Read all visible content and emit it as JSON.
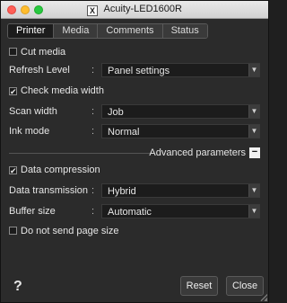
{
  "window": {
    "title": "Acuity-LED1600R",
    "icon": "app-x-icon"
  },
  "tabs": [
    {
      "label": "Printer",
      "active": true
    },
    {
      "label": "Media",
      "active": false
    },
    {
      "label": "Comments",
      "active": false
    },
    {
      "label": "Status",
      "active": false
    }
  ],
  "printer": {
    "cut_media": {
      "label": "Cut media",
      "checked": false
    },
    "refresh_level": {
      "label": "Refresh Level",
      "value": "Panel settings"
    },
    "check_media_width": {
      "label": "Check media width",
      "checked": true
    },
    "scan_width": {
      "label": "Scan width",
      "value": "Job"
    },
    "ink_mode": {
      "label": "Ink mode",
      "value": "Normal"
    },
    "advanced": {
      "label": "Advanced parameters",
      "toggle_symbol": "−"
    },
    "data_compression": {
      "label": "Data compression",
      "checked": true
    },
    "data_transmission": {
      "label": "Data transmission",
      "value": "Hybrid"
    },
    "buffer_size": {
      "label": "Buffer size",
      "value": "Automatic"
    },
    "do_not_send_page_size": {
      "label": "Do not send page size",
      "checked": false
    }
  },
  "colon": ":",
  "check_mark": "✔",
  "select_arrow": "▼",
  "footer": {
    "help": "?",
    "reset_label": "Reset",
    "close_label": "Close"
  }
}
